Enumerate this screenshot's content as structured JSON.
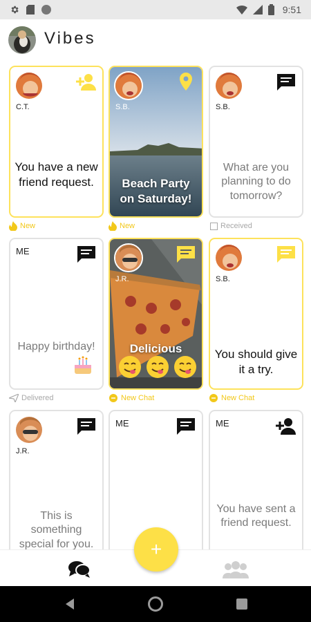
{
  "status_bar": {
    "time": "9:51"
  },
  "app": {
    "title": "Vibes"
  },
  "cards": [
    {
      "initials": "C.T.",
      "message": "You have a new friend request.",
      "status": "New",
      "icon": "add-friend-icon"
    },
    {
      "initials": "S.B.",
      "message": "Beach Party on Saturday!",
      "status": "New",
      "icon": "location-pin-icon"
    },
    {
      "initials": "S.B.",
      "message": "What are you planning to do tomorrow?",
      "status": "Received",
      "icon": "chat-icon"
    },
    {
      "initials": "ME",
      "message": "Happy birthday!",
      "status": "Delivered",
      "icon": "chat-icon"
    },
    {
      "initials": "J.R.",
      "message": "Delicious",
      "status": "New Chat",
      "icon": "chat-icon"
    },
    {
      "initials": "S.B.",
      "message": "You should give it a try.",
      "status": "New Chat",
      "icon": "chat-icon"
    },
    {
      "initials": "J.R.",
      "message": "This is something special for you.",
      "icon": "chat-icon"
    },
    {
      "initials": "ME",
      "message": "",
      "icon": "chat-icon"
    },
    {
      "initials": "ME",
      "message": "You have sent a friend request.",
      "icon": "add-friend-icon"
    }
  ],
  "fab": {
    "label": "+"
  },
  "colors": {
    "accent": "#fde047",
    "border_gray": "#e2e2e2",
    "status_yellow": "#f2c81a"
  }
}
